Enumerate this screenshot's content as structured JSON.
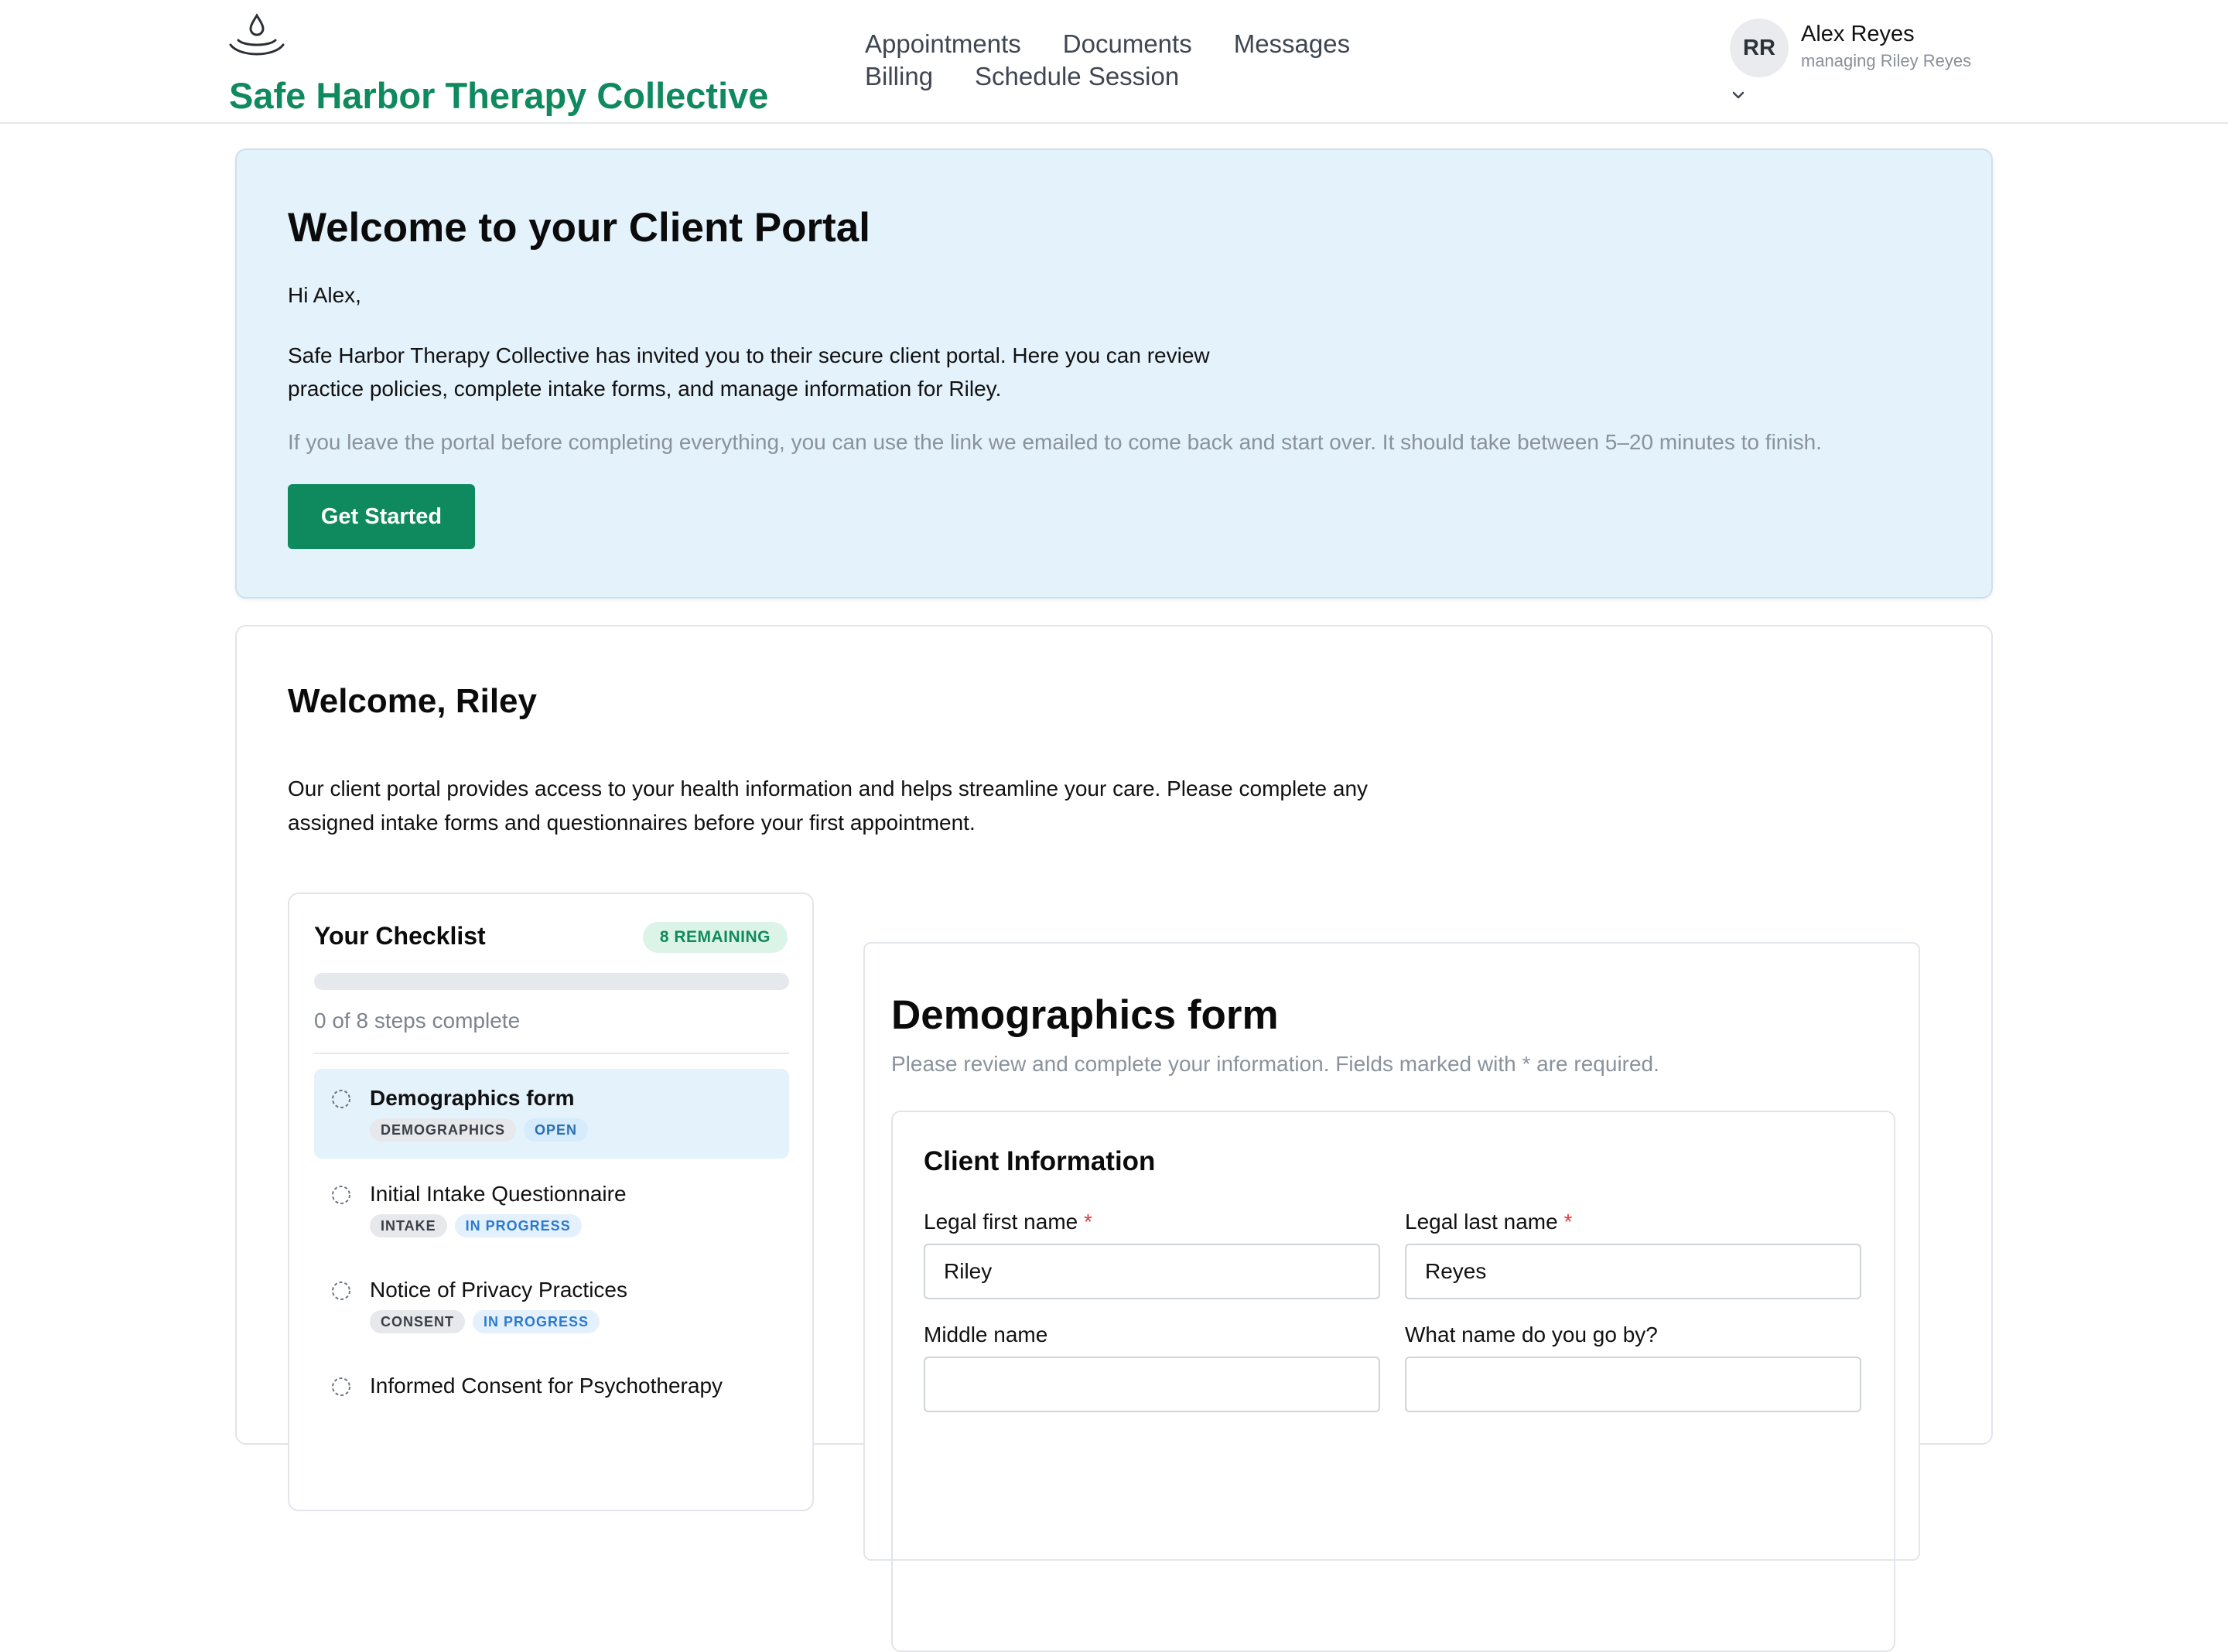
{
  "header": {
    "brand_name": "Safe Harbor Therapy Collective",
    "nav": [
      "Appointments",
      "Documents",
      "Messages",
      "Billing",
      "Schedule Session"
    ],
    "user": {
      "initials": "RR",
      "name": "Alex Reyes",
      "subtitle": "managing Riley Reyes"
    }
  },
  "welcome": {
    "title": "Welcome to your Client Portal",
    "greeting": "Hi Alex,",
    "body": "Safe Harbor Therapy Collective has invited you to their secure client portal. Here you can review practice policies, complete intake forms, and manage information for Riley.",
    "note": "If you leave the portal before completing everything, you can use the link we emailed to come back and start over. It should take between 5–20 minutes to finish.",
    "cta": "Get Started"
  },
  "main": {
    "title": "Welcome, Riley",
    "body": "Our client portal provides access to your health information and helps streamline your care. Please complete any assigned intake forms and questionnaires before your first appointment."
  },
  "checklist": {
    "title": "Your Checklist",
    "remaining_badge": "8 REMAINING",
    "progress": 0,
    "count_text": "0 of 8 steps complete",
    "items": [
      {
        "name": "Demographics form",
        "category": "DEMOGRAPHICS",
        "status": "OPEN"
      },
      {
        "name": "Initial Intake Questionnaire",
        "category": "INTAKE",
        "status": "IN PROGRESS"
      },
      {
        "name": "Notice of Privacy Practices",
        "category": "CONSENT",
        "status": "IN PROGRESS"
      },
      {
        "name": "Informed Consent for Psychotherapy",
        "category": "",
        "status": ""
      }
    ]
  },
  "form": {
    "title": "Demographics form",
    "subtitle": "Please review and complete your information. Fields marked with * are required.",
    "section_title": "Client Information",
    "fields": {
      "first_name": {
        "label": "Legal first name",
        "value": "Riley",
        "required": "*"
      },
      "last_name": {
        "label": "Legal last name",
        "value": "Reyes",
        "required": "*"
      },
      "middle_name": {
        "label": "Middle name",
        "value": ""
      },
      "preferred_name": {
        "label": "What name do you go by?",
        "value": ""
      }
    }
  },
  "colors": {
    "brand": "#0f8a5f",
    "welcome_bg": "#e4f2fc",
    "required": "#e0393b"
  }
}
